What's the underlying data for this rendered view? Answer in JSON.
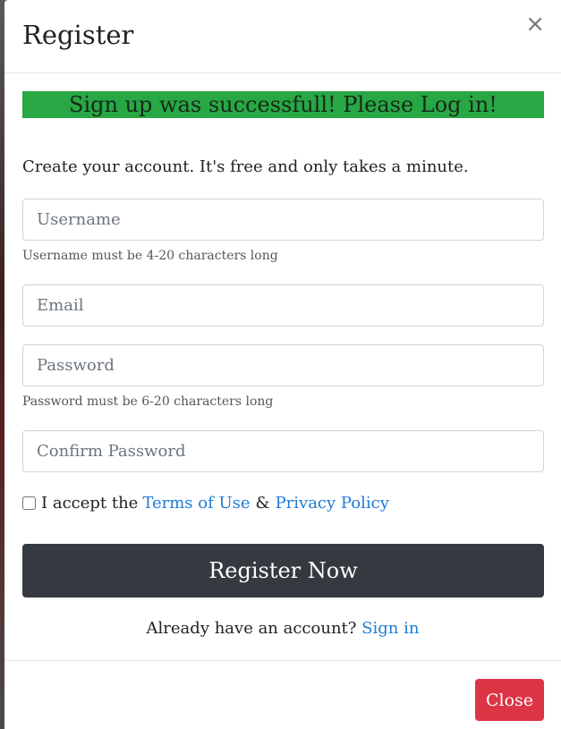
{
  "modal": {
    "title": "Register",
    "close_icon": "×"
  },
  "alert": {
    "text": "Sign up was successfull! Please Log in!",
    "color": "#28a745"
  },
  "form": {
    "intro": "Create your account. It's free and only takes a minute.",
    "username": {
      "value": "",
      "placeholder": "Username",
      "hint": "Username must be 4-20 characters long"
    },
    "email": {
      "value": "",
      "placeholder": "Email"
    },
    "password": {
      "value": "",
      "placeholder": "Password",
      "hint": "Password must be 6-20 characters long"
    },
    "confirm_password": {
      "value": "",
      "placeholder": "Confirm Password"
    },
    "terms": {
      "checked": false,
      "prefix": "I accept the",
      "terms_link": "Terms of Use",
      "amp": "&",
      "privacy_link": "Privacy Policy"
    },
    "submit_label": "Register Now",
    "signin": {
      "prefix": "Already have an account?",
      "link": "Sign in"
    }
  },
  "footer": {
    "close_label": "Close"
  },
  "colors": {
    "primary_dark": "#343a40",
    "danger": "#dc3545",
    "link": "#1e7bd6"
  }
}
